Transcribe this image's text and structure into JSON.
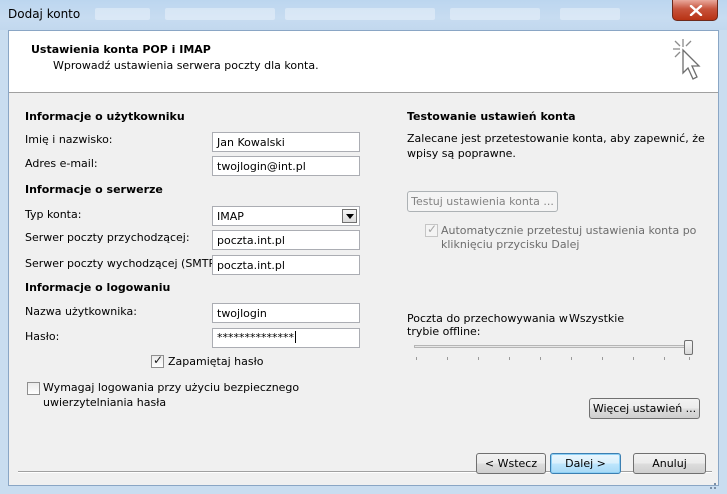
{
  "window": {
    "title": "Dodaj konto"
  },
  "header": {
    "title": "Ustawienia konta POP i IMAP",
    "subtitle": "Wprowadź ustawienia serwera poczty dla konta.",
    "icon": "mouse-cursor-sparkle-icon"
  },
  "user_info": {
    "section": "Informacje o użytkowniku",
    "name_label": "Imię i nazwisko:",
    "name_value": "Jan Kowalski",
    "email_label": "Adres e-mail:",
    "email_value": "twojlogin@int.pl"
  },
  "server_info": {
    "section": "Informacje o serwerze",
    "account_type_label": "Typ konta:",
    "account_type_value": "IMAP",
    "incoming_label": "Serwer poczty przychodzącej:",
    "incoming_value": "poczta.int.pl",
    "outgoing_label": "Serwer poczty wychodzącej (SMTP):",
    "outgoing_value": "poczta.int.pl"
  },
  "logon_info": {
    "section": "Informacje o logowaniu",
    "username_label": "Nazwa użytkownika:",
    "username_value": "twojlogin",
    "password_label": "Hasło:",
    "password_value": "**************",
    "remember_label": "Zapamiętaj hasło",
    "remember_checked": true,
    "spa_label_line1": "Wymagaj logowania przy użyciu bezpiecznego",
    "spa_label_line2": "uwierzytelniania hasła",
    "spa_checked": false
  },
  "test_settings": {
    "section": "Testowanie ustawień konta",
    "desc_line1": "Zalecane jest przetestowanie konta, aby zapewnić, że",
    "desc_line2": "wpisy są poprawne.",
    "test_button": "Testuj ustawienia konta ...",
    "auto_test_line1": "Automatycznie przetestuj ustawienia konta po",
    "auto_test_line2": "kliknięciu przycisku Dalej",
    "auto_test_checked": true
  },
  "offline": {
    "label_line1": "Poczta do przechowywania w",
    "label_line2": "trybie offline:",
    "value": "Wszystkie",
    "slider_level": 1.0
  },
  "buttons": {
    "more_settings": "Więcej ustawień ...",
    "back": "< Wstecz",
    "next": "Dalej >",
    "cancel": "Anuluj"
  },
  "colors": {
    "title_bar": "#c2d8ee",
    "close_button": "#c7533c",
    "dialog_bg": "#f0f0f0"
  }
}
